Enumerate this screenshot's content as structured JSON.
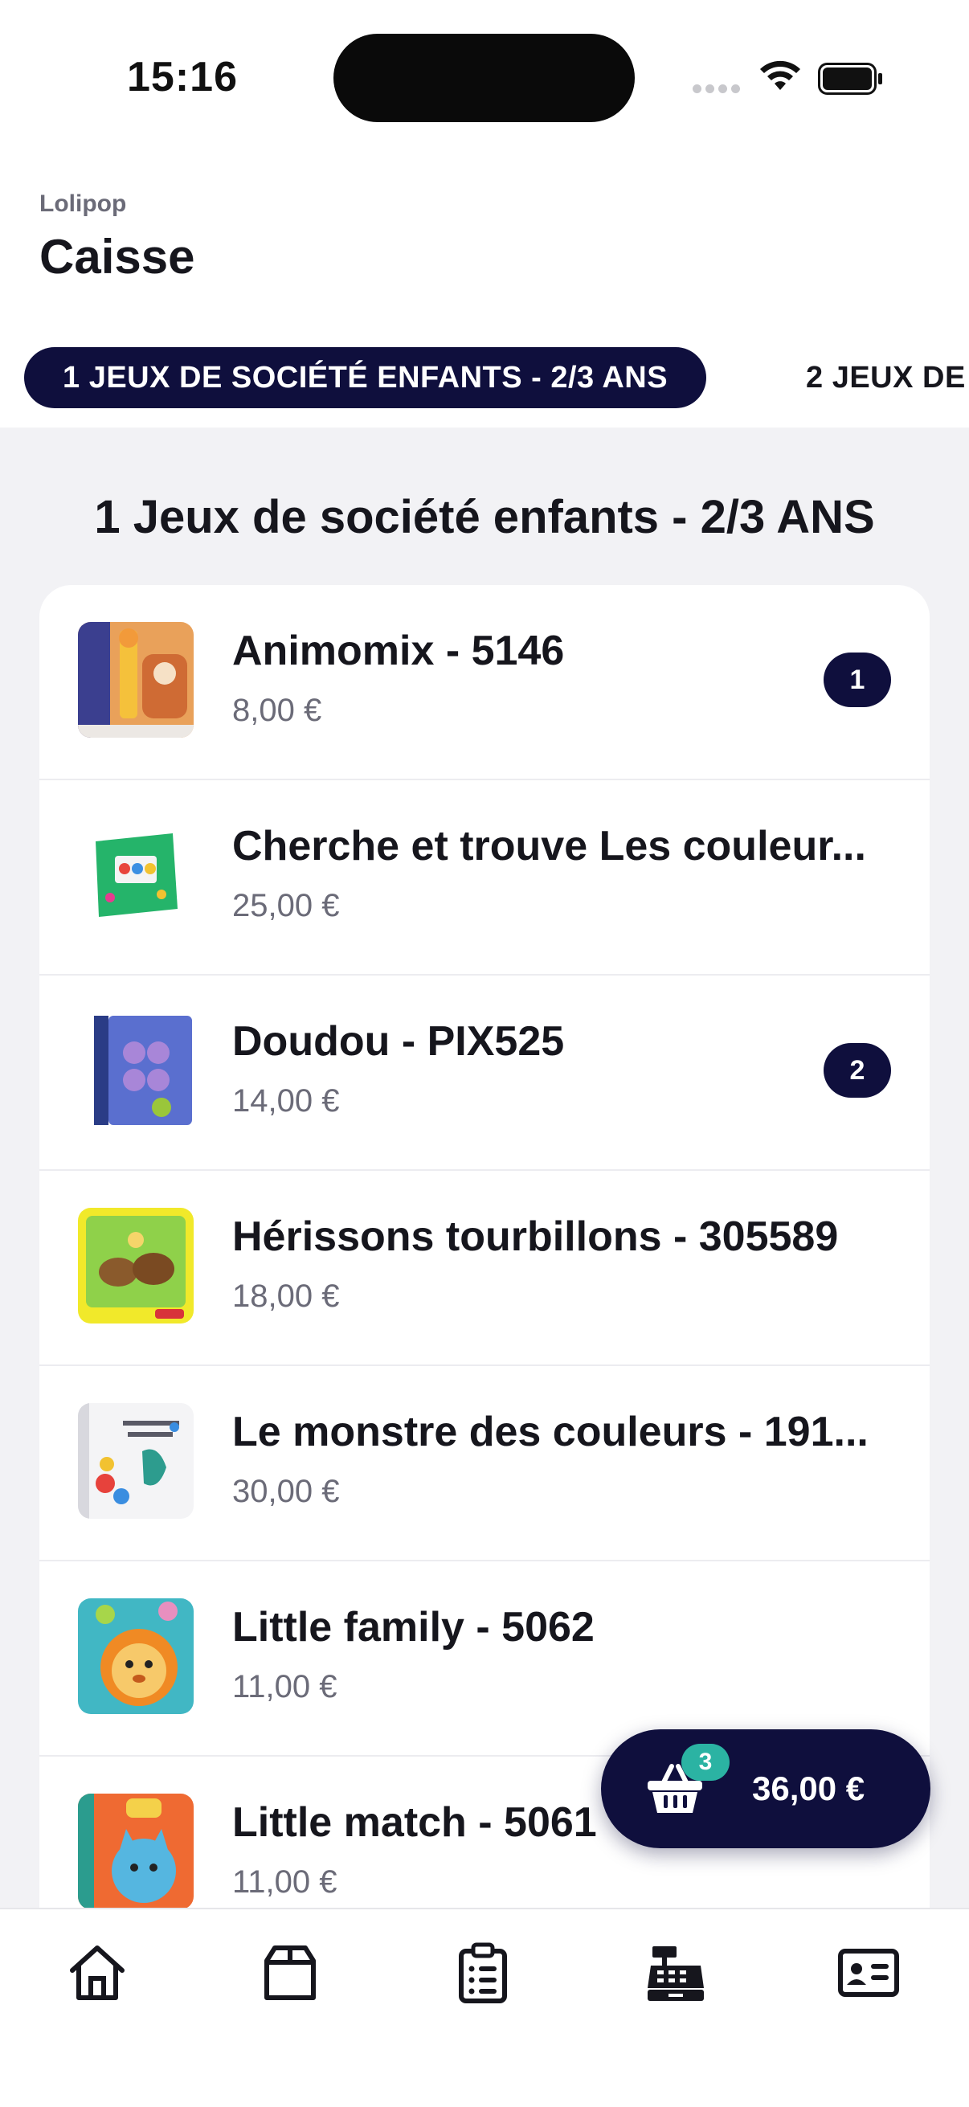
{
  "status_bar": {
    "time": "15:16"
  },
  "header": {
    "brand": "Lolipop",
    "title": "Caisse"
  },
  "tabs": [
    {
      "label": "1 JEUX DE SOCIÉTÉ ENFANTS - 2/3 ANS",
      "active": true
    },
    {
      "label": "2 JEUX DE",
      "active": false
    }
  ],
  "section": {
    "title": "1 Jeux de société enfants - 2/3 ANS"
  },
  "products": [
    {
      "name": "Animomix - 5146",
      "price": "8,00 €",
      "quantity": "1",
      "icon": "animomix-box"
    },
    {
      "name": "Cherche et trouve Les couleur...",
      "price": "25,00 €",
      "quantity": null,
      "icon": "cherche-et-trouve-box"
    },
    {
      "name": "Doudou - PIX525",
      "price": "14,00 €",
      "quantity": "2",
      "icon": "doudou-box"
    },
    {
      "name": "Hérissons tourbillons - 305589",
      "price": "18,00 €",
      "quantity": null,
      "icon": "herissons-box"
    },
    {
      "name": "Le monstre des couleurs - 191...",
      "price": "30,00 €",
      "quantity": null,
      "icon": "monstre-box"
    },
    {
      "name": "Little family - 5062",
      "price": "11,00 €",
      "quantity": null,
      "icon": "little-family-box"
    },
    {
      "name": "Little match - 5061",
      "price": "11,00 €",
      "quantity": null,
      "icon": "little-match-box"
    }
  ],
  "cart": {
    "count": "3",
    "total": "36,00 €",
    "icon": "basket-icon"
  },
  "bottom_nav": [
    {
      "icon": "home-icon",
      "active": false
    },
    {
      "icon": "box-icon",
      "active": false
    },
    {
      "icon": "clipboard-list-icon",
      "active": false
    },
    {
      "icon": "cash-register-icon",
      "active": true
    },
    {
      "icon": "id-card-icon",
      "active": false
    }
  ],
  "colors": {
    "primary": "#0f0f3d",
    "accent": "#2bb3a3",
    "background": "#f2f2f5",
    "muted_text": "#6b6b78"
  }
}
